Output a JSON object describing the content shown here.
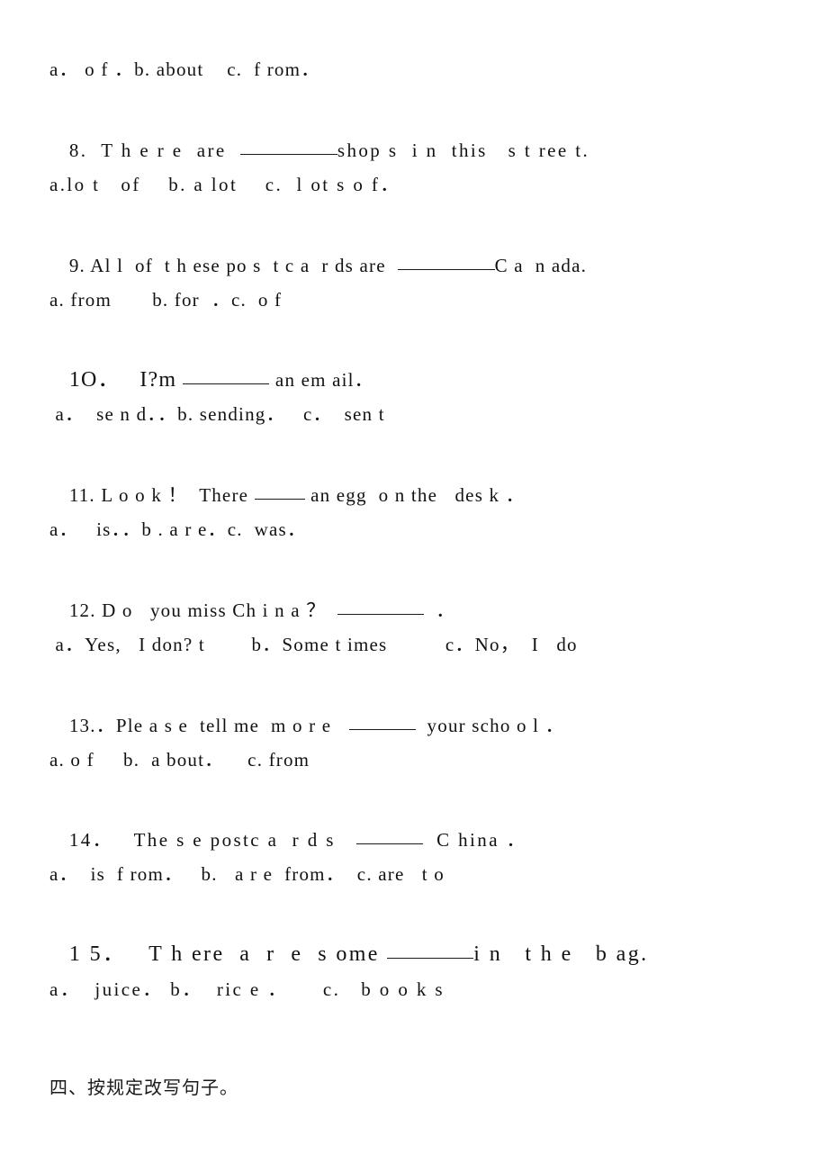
{
  "document": {
    "type": "worksheet",
    "language": "English exercises with Chinese headings",
    "page_background": "#ffffff",
    "text_color": "#111111"
  },
  "carryover_options": {
    "label": "options-for-question-7",
    "text": "a． o f ．b. about    c.  f rom．"
  },
  "questions": [
    {
      "number": "8",
      "stem_before_blank": "8.  T h e r e  are  ",
      "stem_after_blank": "shop s  i n  this   s t ree t.",
      "blank_size": "b-xl",
      "options": "a.lo t   of    b. a lot    c.  l ot s o f．"
    },
    {
      "number": "9",
      "stem_before_blank": "9. Al l  of  t h ese po s  t c a  r ds are  ",
      "stem_after_blank": "C a  n ada.",
      "blank_size": "b-xl",
      "options": "a. from       b. for  ．c.  o f"
    },
    {
      "number": "10",
      "stem_before_blank": "1O．   I?m ",
      "stem_after_blank": " an em ail．",
      "blank_size": "b-lg",
      "options": " a．  se n d．．b. sending．   c．  sen t"
    },
    {
      "number": "11",
      "stem_before_blank": "11. L o o k ！  There ",
      "stem_after_blank": " an egg  o n the   des k ．",
      "blank_size": "b-sm",
      "options": "a．   is．．b . a r e．c.  was．"
    },
    {
      "number": "12",
      "stem_before_blank": "12. D o   you miss Ch i n a ？  ",
      "stem_after_blank": "  ．",
      "blank_size": "b-lg",
      "options": " a．Yes,   I don? t        b．Some t imes          c．No，  I   do"
    },
    {
      "number": "13",
      "stem_before_blank": "13.．Ple a s e  tell me  m o r e   ",
      "stem_after_blank": "  your scho o l ．",
      "blank_size": "b-md",
      "options": "a. o f     b.  a bout．    c. from"
    },
    {
      "number": "14",
      "stem_before_blank": "14．   The s e postc a  r d s   ",
      "stem_after_blank": "  C hina ．",
      "blank_size": "b-md",
      "options": "a．  is  f rom．   b.   a r e  from．  c. are   t o"
    },
    {
      "number": "15",
      "stem_before_blank": "1 5．   T h ere  a  r  e  s ome ",
      "stem_after_blank": "i n   t h e   b ag.",
      "blank_size": "b-lg",
      "options": "a．  juice． b．  ric e ．     c.   b o o k s"
    }
  ],
  "section_heading": {
    "text": "四、按规定改写句子。"
  }
}
